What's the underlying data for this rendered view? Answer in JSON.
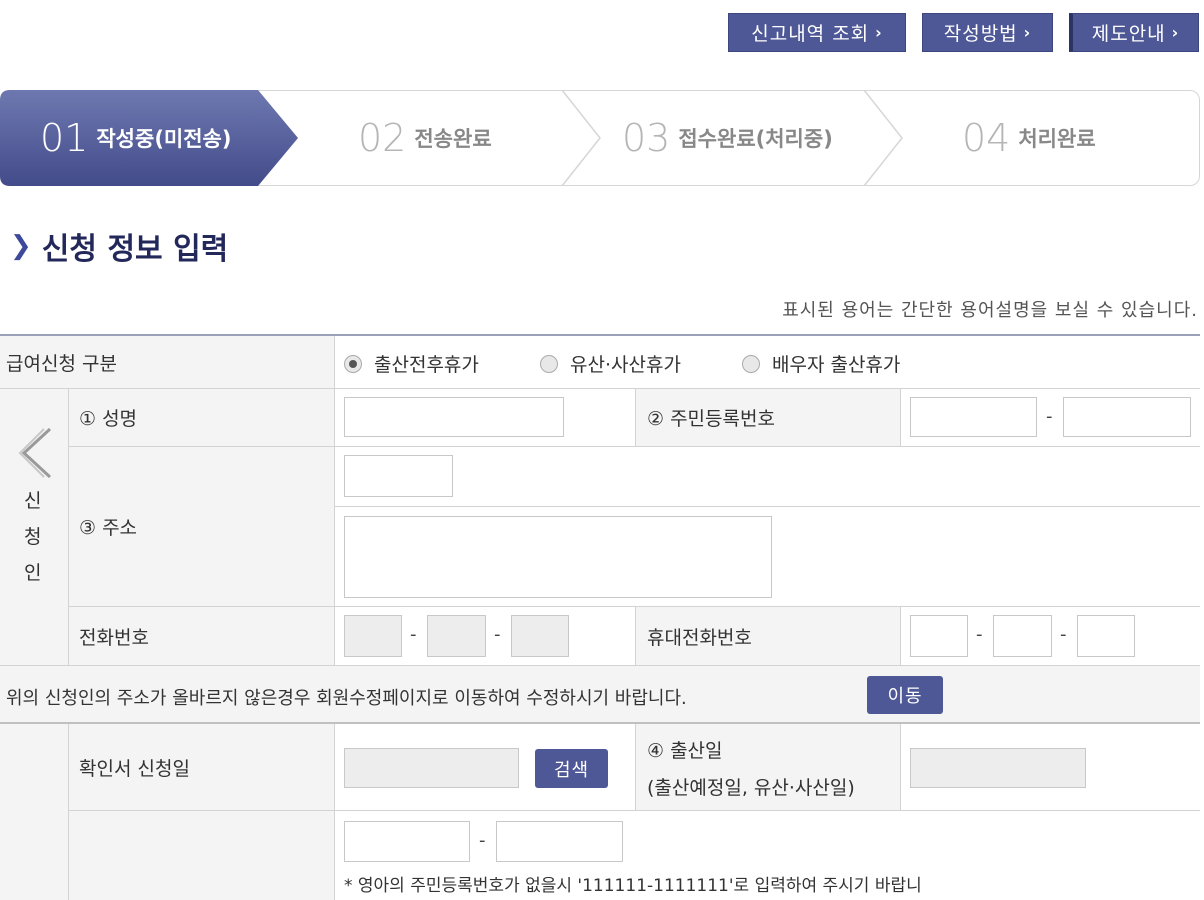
{
  "top_buttons": {
    "history": "신고내역 조회",
    "howto": "작성방법",
    "guide": "제도안내"
  },
  "steps": [
    {
      "num": "01",
      "label": "작성중(미전송)"
    },
    {
      "num": "02",
      "label": "전송완료"
    },
    {
      "num": "03",
      "label": "접수완료(처리중)"
    },
    {
      "num": "04",
      "label": "처리완료"
    }
  ],
  "section_title": "신청 정보 입력",
  "help_note": "표시된 용어는 간단한 용어설명을 보실 수 있습니다.",
  "form": {
    "type_label": "급여신청 구분",
    "type_options": [
      "출산전후휴가",
      "유산·사산휴가",
      "배우자 출산휴가"
    ],
    "type_selected": "출산전후휴가",
    "applicant_label": [
      "신",
      "청",
      "인"
    ],
    "name_label": "① 성명",
    "rrn_label": "② 주민등록번호",
    "address_label": "③ 주소",
    "phone_label": "전화번호",
    "mobile_label": "휴대전화번호",
    "address_notice": "위의 신청인의 주소가 올바르지 않은경우 회원수정페이지로 이동하여 수정하시기 바랍니다.",
    "move_button": "이동",
    "confirm_date_label": "확인서 신청일",
    "search_button": "검색",
    "birth_label": "④ 출산일",
    "birth_sub": "(출산예정일, 유산·사산일)",
    "infant_note": "* 영아의 주민등록번호가 없을시 '111111-1111111'로 입력하여 주시기 바랍니",
    "dash": "-"
  },
  "colors": {
    "accent": "#4e5896",
    "title": "#23285a",
    "label_bg": "#f4f4f4"
  }
}
